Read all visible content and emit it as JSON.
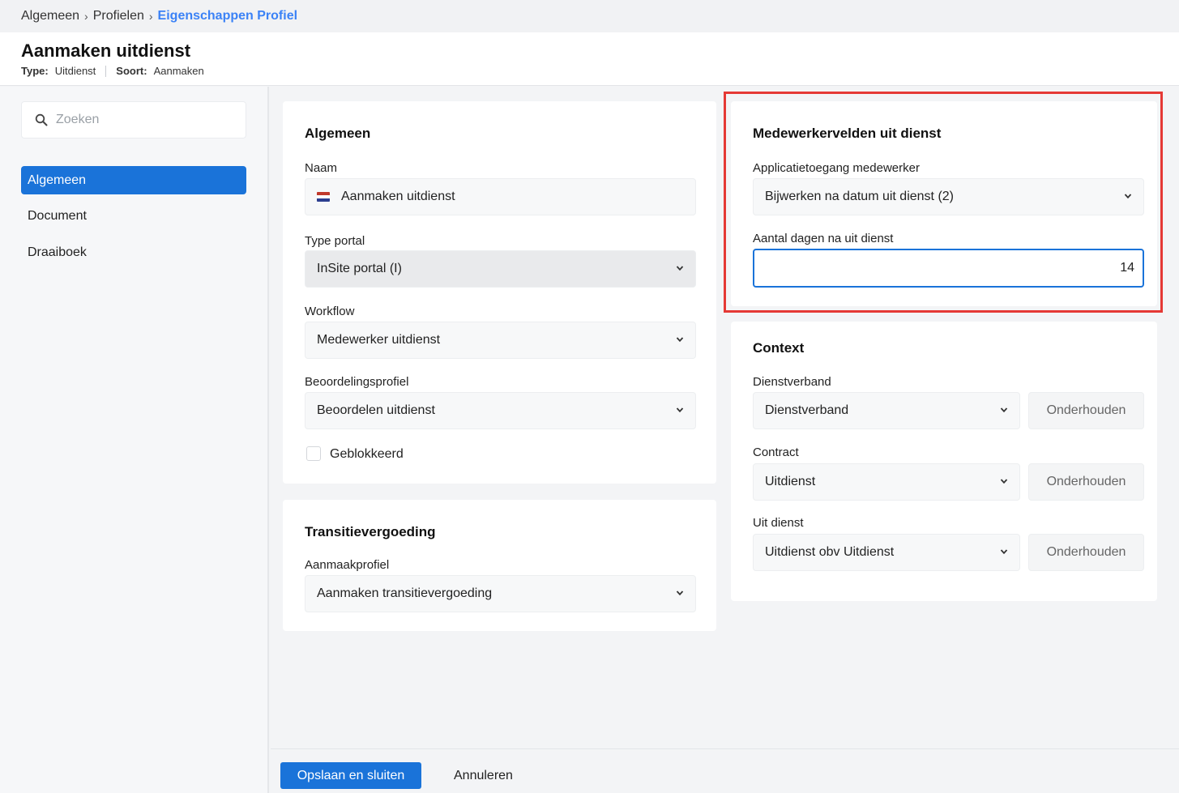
{
  "breadcrumb": {
    "items": [
      "Algemeen",
      "Profielen"
    ],
    "current": "Eigenschappen Profiel"
  },
  "header": {
    "title": "Aanmaken uitdienst",
    "type_label": "Type:",
    "type_value": "Uitdienst",
    "soort_label": "Soort:",
    "soort_value": "Aanmaken"
  },
  "sidebar": {
    "search_placeholder": "Zoeken",
    "items": [
      {
        "label": "Algemeen",
        "active": true
      },
      {
        "label": "Document",
        "active": false
      },
      {
        "label": "Draaiboek",
        "active": false
      }
    ]
  },
  "algemeen": {
    "title": "Algemeen",
    "naam_label": "Naam",
    "naam_value": "Aanmaken uitdienst",
    "type_portal_label": "Type portal",
    "type_portal_value": "InSite portal (I)",
    "workflow_label": "Workflow",
    "workflow_value": "Medewerker uitdienst",
    "beoordeling_label": "Beoordelingsprofiel",
    "beoordeling_value": "Beoordelen uitdienst",
    "geblokkeerd_label": "Geblokkeerd",
    "geblokkeerd_checked": false
  },
  "transitie": {
    "title": "Transitievergoeding",
    "aanmaak_label": "Aanmaakprofiel",
    "aanmaak_value": "Aanmaken transitievergoeding"
  },
  "medewerker": {
    "title": "Medewerkervelden uit dienst",
    "toegang_label": "Applicatietoegang medewerker",
    "toegang_value": "Bijwerken na datum uit dienst (2)",
    "dagen_label": "Aantal dagen na uit dienst",
    "dagen_value": "14"
  },
  "context": {
    "title": "Context",
    "dienstverband_label": "Dienstverband",
    "dienstverband_value": "Dienstverband",
    "contract_label": "Contract",
    "contract_value": "Uitdienst",
    "uitdienst_label": "Uit dienst",
    "uitdienst_value": "Uitdienst obv Uitdienst",
    "onderhouden_label": "Onderhouden"
  },
  "footer": {
    "save_label": "Opslaan en sluiten",
    "cancel_label": "Annuleren"
  },
  "colors": {
    "accent": "#1a73d9",
    "highlight": "#e53935",
    "breadcrumb_current": "#3b82f6"
  },
  "icons": {
    "search": "search-icon",
    "dropdown": "chevron-down-icon",
    "flag": "dutch-flag-icon"
  }
}
